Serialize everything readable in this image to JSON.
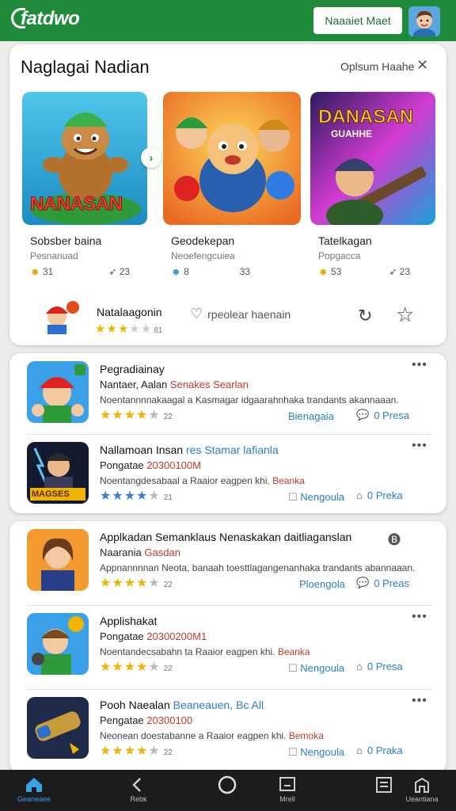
{
  "header": {
    "logo": "fatdwo",
    "button_label": "Naaaiet Maet",
    "colors": {
      "bar": "#1f8a3a",
      "accent": "#3a7fc8"
    }
  },
  "featured": {
    "title": "Naglagai Nadian",
    "link": "Oplsum Haahe",
    "close": "✕",
    "cards": [
      {
        "art_text": "NANASAN",
        "name": "Sobsber baina",
        "sub": "Pesnanuad",
        "stat1": "31",
        "stat2": "23"
      },
      {
        "art_text": "",
        "name": "Geodekepan",
        "sub": "Neoefengcuiea",
        "stat1": "8",
        "stat2": "33"
      },
      {
        "art_text": "DANASAN",
        "art_sub": "GUAHHE",
        "name": "Tatelkagan",
        "sub": "Popgacca",
        "stat1": "53",
        "stat2": "23"
      }
    ],
    "mini": {
      "name": "Natalaagonin",
      "rating": 3,
      "count": "81",
      "action": "rpeolear haenain"
    }
  },
  "list1": [
    {
      "name": "Pegradiainay",
      "sub": "Nantaer, Aalan",
      "sub_accent": "Senakes Searlan",
      "desc": "Noentannnnakaagal a Kasmagar idgaarahnhaka trandants akannaaan.",
      "desc_accent": "",
      "rating": 4,
      "count": "22",
      "star_color": "gold",
      "act1": "Bienagaia",
      "act2": "0 Presa"
    },
    {
      "name": "Nallamoan Insan",
      "name_accent": "res Stamar lafianla",
      "sub": "Pongatae",
      "sub_accent": "20300100M",
      "desc": "Noentangdesabaal a Raaior eagpen khi.",
      "desc_accent": "Beanka",
      "rating": 4,
      "count": "21",
      "star_color": "blue",
      "act1": "Nengoula",
      "act2": "0 Preka"
    }
  ],
  "list2": [
    {
      "name": "Applkadan Semanklaus Nenaskakan daitliaganslan",
      "badge": "🅑",
      "sub": "Naarania",
      "sub_accent": "Gasdan",
      "desc": "Appnannnnan Neota, banaah toesttlagangenanhaka trandants abannaaan.",
      "desc_accent": "",
      "rating": 4,
      "count": "22",
      "star_color": "gold",
      "act1": "Ploengola",
      "act2": "0 Preas"
    },
    {
      "name": "Applishakat",
      "sub": "Pongatae",
      "sub_accent": "20300200M1",
      "desc": "Noentandecsabahn ta Raaior eagpen khi.",
      "desc_accent": "Beanka",
      "rating": 4,
      "count": "22",
      "star_color": "gold",
      "act1": "Nengoula",
      "act2": "0 Presa"
    },
    {
      "name": "Pooh Naealan",
      "name_accent": "Beaneauen, Bc All",
      "sub": "Pengatae",
      "sub_accent": "20300100",
      "desc": "Neonean doestabanne a Raaior eagpen khi.",
      "desc_accent": "Bemoka",
      "rating": 4,
      "count": "22",
      "star_color": "gold",
      "act1": "Nengoula",
      "act2": "0 Praka"
    }
  ],
  "nav": [
    {
      "label": "Geaneaee",
      "icon": "home-icon",
      "active": true
    },
    {
      "label": "Rebk",
      "icon": "back-icon",
      "active": false
    },
    {
      "label": "",
      "icon": "circle-home-icon",
      "active": false
    },
    {
      "label": "Mrell",
      "icon": "square-icon",
      "active": false
    },
    {
      "label": "",
      "icon": "list-icon",
      "active": false
    },
    {
      "label": "Ueantiana",
      "icon": "profile-icon",
      "active": false
    }
  ]
}
